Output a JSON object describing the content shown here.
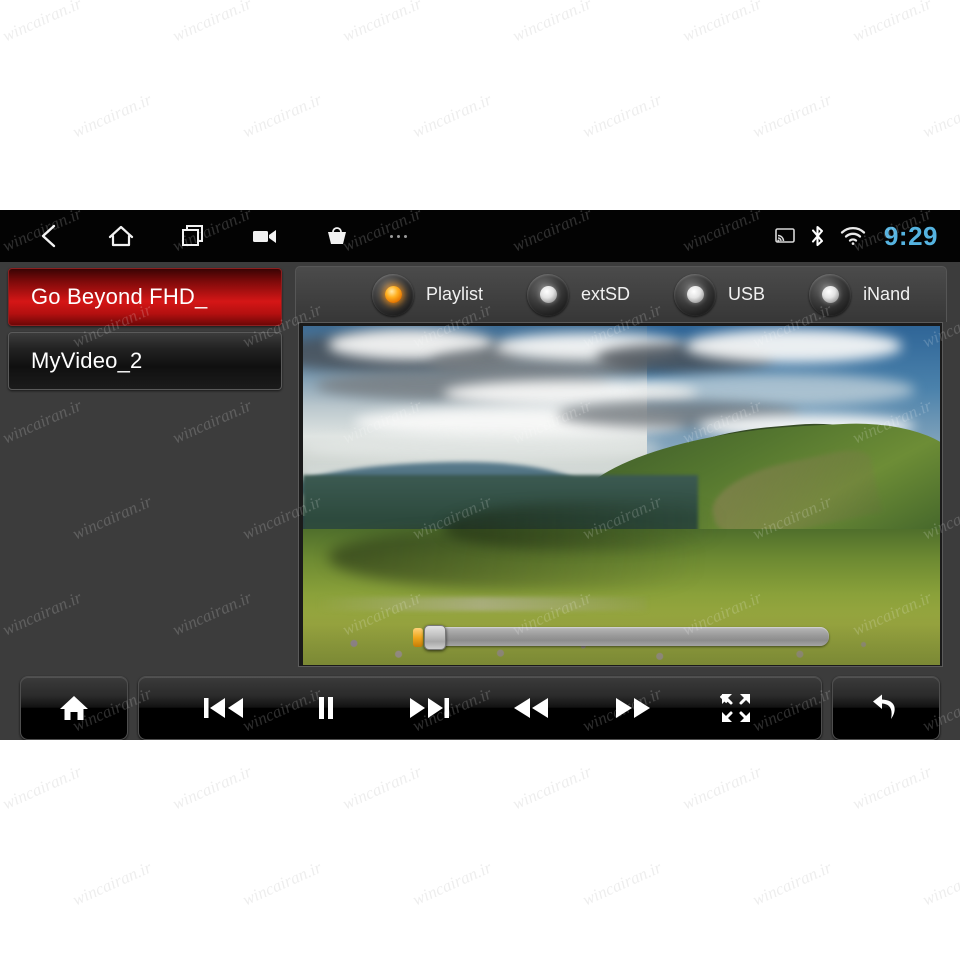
{
  "statusbar": {
    "nav_icons": [
      {
        "name": "back-icon",
        "label": "Back"
      },
      {
        "name": "home-icon",
        "label": "Home"
      },
      {
        "name": "recents-icon",
        "label": "Recent apps"
      },
      {
        "name": "camcorder-icon",
        "label": "Camcorder"
      },
      {
        "name": "basket-icon",
        "label": "Basket"
      }
    ],
    "more_label": "More",
    "indicators": [
      {
        "name": "screencast-icon",
        "label": "Screencast"
      },
      {
        "name": "bluetooth-icon",
        "label": "Bluetooth"
      },
      {
        "name": "wifi-icon",
        "label": "Wi-Fi"
      }
    ],
    "clock": "9:29",
    "clock_color": "#55b3e0",
    "background_color": "#030303"
  },
  "playlist": {
    "items": [
      {
        "label": "Go Beyond FHD_",
        "selected": true
      },
      {
        "label": "MyVideo_2",
        "selected": false
      }
    ],
    "selected_color": "#d51616"
  },
  "sources": {
    "options": [
      {
        "label": "Playlist",
        "active": true
      },
      {
        "label": "extSD",
        "active": false
      },
      {
        "label": "USB",
        "active": false
      },
      {
        "label": "iNand",
        "active": false
      }
    ],
    "active_led_color": "#ffb020",
    "inactive_led_color": "#e3e3e3"
  },
  "video": {
    "title": "Go Beyond FHD_",
    "scene_description": "Mountain valley with green alpine meadow and cloudy sky",
    "seek": {
      "progress_percent": 3,
      "name": "video-seek-bar"
    }
  },
  "controls": {
    "home": {
      "label": "Home",
      "icon": "home-icon"
    },
    "back": {
      "label": "Back",
      "icon": "return-arrow-icon"
    },
    "transport": [
      {
        "label": "Previous",
        "icon": "previous-track-icon"
      },
      {
        "label": "Pause",
        "icon": "pause-icon"
      },
      {
        "label": "Next",
        "icon": "next-track-icon"
      },
      {
        "label": "Rewind",
        "icon": "rewind-icon"
      },
      {
        "label": "Fast forward",
        "icon": "fast-forward-icon"
      },
      {
        "label": "Fullscreen",
        "icon": "fullscreen-icon"
      }
    ]
  },
  "watermark": {
    "text": "wincairan.ir"
  },
  "theme": {
    "page_background": "#ffffff",
    "device_background": "#3c3c3c",
    "panel_background": "#414141"
  }
}
